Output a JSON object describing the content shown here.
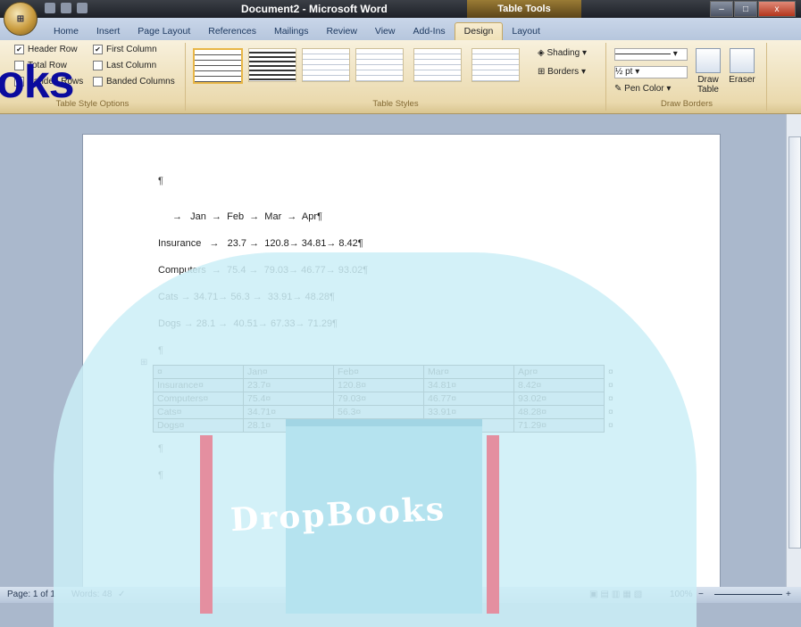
{
  "titlebar": {
    "title": "Document2 - Microsoft Word",
    "contextual": "Table Tools",
    "window_buttons": {
      "minimize": "–",
      "maximize": "□",
      "close": "x"
    }
  },
  "ribbon_tabs": [
    {
      "label": "Home"
    },
    {
      "label": "Insert"
    },
    {
      "label": "Page Layout"
    },
    {
      "label": "References"
    },
    {
      "label": "Mailings"
    },
    {
      "label": "Review"
    },
    {
      "label": "View"
    },
    {
      "label": "Add-Ins"
    },
    {
      "label": "Design",
      "active": true
    },
    {
      "label": "Layout"
    }
  ],
  "ribbon": {
    "style_options": {
      "header_row": "Header Row",
      "first_column": "First Column",
      "total_row": "Total Row",
      "last_column": "Last Column",
      "banded_rows": "Banded Rows",
      "banded_columns": "Banded Columns",
      "group_label": "Table Style Options",
      "check": "✔"
    },
    "table_styles": {
      "group_label": "Table Styles",
      "shading": "Shading",
      "borders": "Borders"
    },
    "draw_borders": {
      "pen_weight": "½ pt",
      "pen_color": "Pen Color",
      "draw_table_1": "Draw",
      "draw_table_2": "Table",
      "eraser": "Eraser",
      "group_label": "Draw Borders"
    }
  },
  "document": {
    "para_mark": "¶",
    "tab_lines": [
      "→   Jan  →  Feb  →  Mar  →  Apr¶",
      "Insurance   →   23.7 →  120.8→ 34.81→ 8.42¶",
      "Computers  →  75.4 →  79.03→ 46.77→ 93.02¶",
      "Cats → 34.71→ 56.3 →  33.91→ 48.28¶",
      "Dogs → 28.1 →  40.51→ 67.33→ 71.29¶"
    ],
    "table": {
      "header": [
        "¤",
        "Jan¤",
        "Feb¤",
        "Mar¤",
        "Apr¤"
      ],
      "rows": [
        [
          "Insurance¤",
          "23.7¤",
          "120.8¤",
          "34.81¤",
          "8.42¤"
        ],
        [
          "Computers¤",
          "75.4¤",
          "79.03¤",
          "46.77¤",
          "93.02¤"
        ],
        [
          "Cats¤",
          "34.71¤",
          "56.3¤",
          "33.91¤",
          "48.28¤"
        ],
        [
          "Dogs¤",
          "28.1¤",
          "40.51¤",
          "67.33¤",
          "71.29¤"
        ]
      ],
      "end_mark": "¤",
      "move_handle": "⊞"
    }
  },
  "statusbar": {
    "page": "Page: 1 of 1",
    "words": "Words: 48",
    "zoom": "100%",
    "zoom_out": "−",
    "zoom_in": "+"
  },
  "watermark": {
    "logo": "DropBooks",
    "corner": "oks"
  },
  "colors": {
    "title_bg": "#1d2027",
    "ribbon_bg": "#f8f1dd",
    "table_fill": "#c9d1dc",
    "watermark_teal": "#cbeef7",
    "watermark_pink": "#e48fa0",
    "corner_text": "#0b0b9e"
  }
}
